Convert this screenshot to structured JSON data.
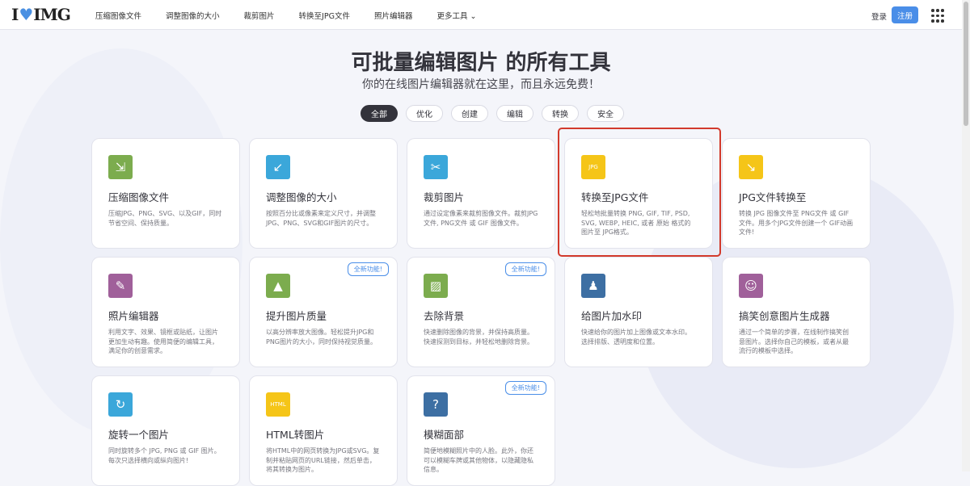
{
  "header": {
    "logo": "I♥IMG",
    "nav": [
      "压缩图像文件",
      "调整图像的大小",
      "裁剪图片",
      "转换至JPG文件",
      "照片编辑器",
      "更多工具 ⌄"
    ],
    "login": "登录",
    "signup": "注册"
  },
  "hero": {
    "title": "可批量编辑图片 的所有工具",
    "subtitle": "你的在线图片编辑器就在这里，而且永远免费！"
  },
  "filters": [
    "全部",
    "优化",
    "创建",
    "编辑",
    "转换",
    "安全"
  ],
  "active_filter": "全部",
  "colors": {
    "accent": "#4a8ee8",
    "highlight": "#d23a2c"
  },
  "tools": [
    {
      "title": "压缩图像文件",
      "desc": "压缩JPG、PNG、SVG、以及GIF，同时节省空间、保持质量。",
      "icon": "compress-icon",
      "color": "#7cac4e",
      "glyph": "⇲"
    },
    {
      "title": "调整图像的大小",
      "desc": "按照百分比或像素来定义尺寸，并调整JPG、PNG、SVG和GIF图片的尺寸。",
      "icon": "resize-icon",
      "color": "#3ba7da",
      "glyph": "↙"
    },
    {
      "title": "裁剪图片",
      "desc": "通过设定像素来裁剪图像文件。裁剪JPG文件, PNG文件 或 GIF 图像文件。",
      "icon": "scissors-icon",
      "color": "#3ba7da",
      "glyph": "✂"
    },
    {
      "title": "转换至JPG文件",
      "desc": "轻松地批量转换 PNG, GIF, TIF, PSD, SVG, WEBP, HEIC, 或者 原始 格式的图片至 JPG格式。",
      "icon": "convert-to-jpg-icon",
      "color": "#f5c518",
      "glyph": "JPG"
    },
    {
      "title": "JPG文件转换至",
      "desc": "转换 JPG 图像文件至 PNG文件 或 GIF 文件。用多个JPG文件创建一个 GIF动画文件!",
      "icon": "convert-from-jpg-icon",
      "color": "#f5c518",
      "glyph": "↘"
    },
    {
      "title": "照片编辑器",
      "desc": "利用文字、效果、镜框或贴纸，让图片更加生动有趣。使用简便的编辑工具，满足你的创意需求。",
      "icon": "pencil-icon",
      "color": "#a0609a",
      "glyph": "✎"
    },
    {
      "title": "提升图片质量",
      "desc": "以高分辨率放大图像。轻松提升JPG和PNG图片的大小，同时保持视觉质量。",
      "icon": "upscale-icon",
      "color": "#7cac4e",
      "glyph": "▲",
      "badge": "全新功能!"
    },
    {
      "title": "去除背景",
      "desc": "快速删除图像的背景，并保持高质量。快速探测到目标，并轻松地删除背景。",
      "icon": "remove-background-icon",
      "color": "#7cac4e",
      "glyph": "▨",
      "badge": "全新功能!"
    },
    {
      "title": "给图片加水印",
      "desc": "快速给你的图片加上图像或文本水印。选择排版、透明度和位置。",
      "icon": "stamp-icon",
      "color": "#3d6fa3",
      "glyph": "♟"
    },
    {
      "title": "搞笑创意图片生成器",
      "desc": "通过一个简单的步骤，在线制作搞笑创意图片。选择你自己的模板，或者从最流行的模板中选择。",
      "icon": "laugh-icon",
      "color": "#a0609a",
      "glyph": "☺"
    },
    {
      "title": "旋转一个图片",
      "desc": "同时旋转多个 JPG, PNG 或 GIF 图片。每次只选择横向或纵向图片!",
      "icon": "rotate-icon",
      "color": "#3ba7da",
      "glyph": "↻"
    },
    {
      "title": "HTML转图片",
      "desc": "将HTML中的网页转换为JPG或SVG。复制并粘贴网页的URL链接，然后单击，将其转换为图片。",
      "icon": "html-to-image-icon",
      "color": "#f5c518",
      "glyph": "HTML"
    },
    {
      "title": "模糊面部",
      "desc": "简便地模糊照片中的人脸。此外，你还可以模糊车牌或其他物体，以隐藏隐私信息。",
      "icon": "blur-face-icon",
      "color": "#3d6fa3",
      "glyph": "?",
      "badge": "全新功能!"
    }
  ]
}
